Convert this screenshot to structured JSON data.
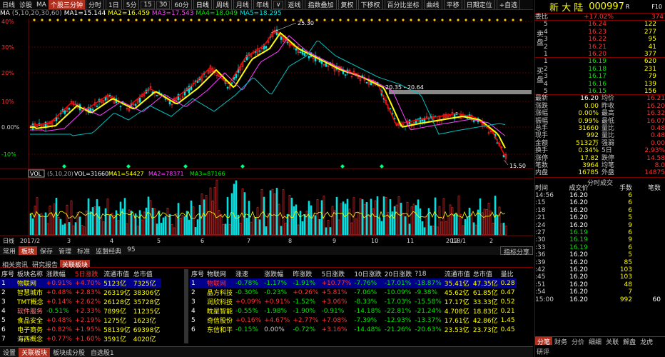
{
  "toolbar": {
    "items": [
      "日线",
      "诊股",
      "MA",
      "个股三分钟",
      "分时",
      "1日",
      "5分",
      "15",
      "30",
      "60分",
      "日线",
      "周线",
      "月线",
      "年线",
      "∨",
      "返线",
      "指数叠加",
      "复权",
      "下移权",
      "百分比坐标",
      "曲线",
      "平移",
      "日期定位",
      "+自选"
    ]
  },
  "ma": {
    "label": "MA",
    "params": "(5,10,20,30,60)",
    "ma1": "MA1=15.144",
    "ma2": "MA2=16.459",
    "ma3": "MA3=17.543",
    "ma4": "MA4=18.049",
    "ma5": "MA5=18.295"
  },
  "price_axis": [
    "40%",
    "30%",
    "20%",
    "10%",
    "0.00%",
    "-10%"
  ],
  "annotations": {
    "high": "25.30",
    "mid": "20.35 - 20.64",
    "low": "15.50"
  },
  "vol": {
    "label": "VOL",
    "params": "(5,10,20)",
    "vol": "VOL=31660",
    "ma1": "MA1=54427",
    "ma2": "MA2=78371",
    "ma3": "MA3=87166"
  },
  "date_axis": [
    "日线",
    "2017/2",
    "3",
    "4",
    "5",
    "6",
    "7",
    "8",
    "9",
    "10",
    "11",
    "12",
    "2018/1",
    "2"
  ],
  "tabs1": [
    "常用",
    "板块",
    "保存",
    "管理",
    "标准",
    "监盟经典",
    "95"
  ],
  "tabs1_right": "指标分享",
  "info_tabs": [
    "相关资讯",
    "研究报告",
    "关联板块"
  ],
  "left_table": {
    "headers": [
      "序号",
      "板块名称",
      "涨跌幅",
      "5日涨跌",
      "流通市值",
      "总市值"
    ],
    "rows": [
      [
        "1",
        "物联网",
        "+0.91%",
        "+4.70%",
        "5123亿",
        "7325亿"
      ],
      [
        "2",
        "智慧城市",
        "+0.48%",
        "+2.83%",
        "26319亿",
        "38306亿"
      ],
      [
        "3",
        "TMT概念",
        "+0.14%",
        "+2.62%",
        "26128亿",
        "35728亿"
      ],
      [
        "4",
        "软件服务",
        "-0.51%",
        "+2.33%",
        "7899亿",
        "11235亿"
      ],
      [
        "5",
        "食品安全",
        "+0.48%",
        "+2.19%",
        "1275亿",
        "1623亿"
      ],
      [
        "6",
        "电子商务",
        "+0.82%",
        "+1.95%",
        "58139亿",
        "69398亿"
      ],
      [
        "7",
        "海西概念",
        "+0.77%",
        "+1.60%",
        "3591亿",
        "4020亿"
      ]
    ]
  },
  "right_table": {
    "headers": [
      "序号",
      "物联网",
      "涨速",
      "涨跌幅",
      "昨涨跌",
      "5日涨跌",
      "10日涨跌",
      "20日涨跌",
      "?18",
      "流通市值",
      "总市值",
      "量比"
    ],
    "rows": [
      [
        "1",
        "物联网",
        "-0.78%",
        "-1.17%",
        "-1.91%",
        "+10.77%",
        "-7.76%",
        "-17.01%",
        "-18.87%",
        "35.41亿",
        "47.35亿",
        "0.28"
      ],
      [
        "2",
        "晶方科技",
        "-0.30%",
        "-0.23%",
        "+0.26%",
        "+5.81%",
        "-7.06%",
        "-10.09%",
        "-9.38%",
        "45.62亿",
        "61.85亿",
        "0.47"
      ],
      [
        "3",
        "润欣科技",
        "+0.09%",
        "+0.91%",
        "-1.52%",
        "+3.06%",
        "-8.33%",
        "-17.03%",
        "-15.58%",
        "17.17亿",
        "33.33亿",
        "0.52"
      ],
      [
        "4",
        "眈星智能",
        "-0.55%",
        "-1.98%",
        "-1.90%",
        "-0.91%",
        "-14.18%",
        "-22.81%",
        "-21.24%",
        "4.708亿",
        "18.83亿",
        "0.21"
      ],
      [
        "5",
        "奇信股份",
        "+0.16%",
        "+4.67%",
        "+2.77%",
        "+7.08%",
        "-7.39%",
        "-12.93%",
        "-13.37%",
        "17.61亿",
        "42.86亿",
        "1.45"
      ],
      [
        "6",
        "东信和平",
        "-0.15%",
        "0.00%",
        "-0.72%",
        "+3.16%",
        "-14.48%",
        "-21.26%",
        "-20.63%",
        "23.53亿",
        "23.73亿",
        "0.45"
      ]
    ]
  },
  "bottom_tabs": [
    "设置",
    "关联板块",
    "板块成分股",
    "自选股1"
  ],
  "stock": {
    "name": "新 大 陆",
    "code": "000997",
    "r": "R",
    "f10": "F10"
  },
  "order": {
    "wb_label": "委比",
    "wb": "+17.02%",
    "wc": "374",
    "sell": [
      [
        "5",
        "16.24",
        "122"
      ],
      [
        "4",
        "16.23",
        "277"
      ],
      [
        "3",
        "16.22",
        "95"
      ],
      [
        "2",
        "16.21",
        "41"
      ],
      [
        "1",
        "16.20",
        "377"
      ]
    ],
    "buy": [
      [
        "1",
        "16.19",
        "620"
      ],
      [
        "2",
        "16.18",
        "231"
      ],
      [
        "3",
        "16.17",
        "79"
      ],
      [
        "4",
        "16.16",
        "139"
      ],
      [
        "5",
        "16.15",
        "156"
      ]
    ],
    "sell_label": "卖 盘",
    "buy_label": "买 盘"
  },
  "quote": [
    [
      "最新",
      "16.20",
      "均价",
      "16.21"
    ],
    [
      "涨跌",
      "0.00",
      "昨收",
      "16.20"
    ],
    [
      "涨幅",
      "0.00%",
      "最高",
      "16.32"
    ],
    [
      "振幅",
      "0.99%",
      "最低",
      "16.07"
    ],
    [
      "总手",
      "31660",
      "量比",
      "0.48"
    ],
    [
      "现手",
      "992",
      "量比",
      "0.48"
    ],
    [
      "金额",
      "5132万",
      "强弱",
      "0.00"
    ],
    [
      "换手",
      "0.34%",
      "5日",
      "2.93%"
    ],
    [
      "涨停",
      "17.82",
      "跌停",
      "14.58"
    ],
    [
      "笔数",
      "3964",
      "均笔",
      "8.0"
    ],
    [
      "内盘",
      "16785",
      "外盘",
      "14875"
    ]
  ],
  "ticks_header": {
    "title": "分时成交",
    "h1": "时间",
    "h2": "成交价",
    "h3": "手数",
    "h4": "笔数"
  },
  "ticks": [
    [
      "14:56",
      "16.20",
      "6"
    ],
    [
      ":15",
      "16.20",
      "6"
    ],
    [
      ":18",
      "16.20",
      "6"
    ],
    [
      ":21",
      "16.20",
      "5"
    ],
    [
      ":24",
      "16.20",
      "9"
    ],
    [
      ":27",
      "16.19",
      "6"
    ],
    [
      ":30",
      "16.19",
      "9"
    ],
    [
      ":33",
      "16.19",
      "6"
    ],
    [
      ":36",
      "16.20",
      "5"
    ],
    [
      ":39",
      "16.20",
      "85"
    ],
    [
      ":42",
      "16.20",
      "103"
    ],
    [
      ":45",
      "16.20",
      "103"
    ],
    [
      ":51",
      "16.20",
      "48"
    ],
    [
      ":54",
      "16.20",
      "7"
    ],
    [
      "15:00",
      "16.20",
      "992"
    ]
  ],
  "ticks_extra": "60",
  "rp_tabs": [
    "分笔",
    "财务",
    "分价",
    "细细",
    "关联",
    "解盘",
    "龙虎"
  ],
  "rp_bottom": "研评"
}
